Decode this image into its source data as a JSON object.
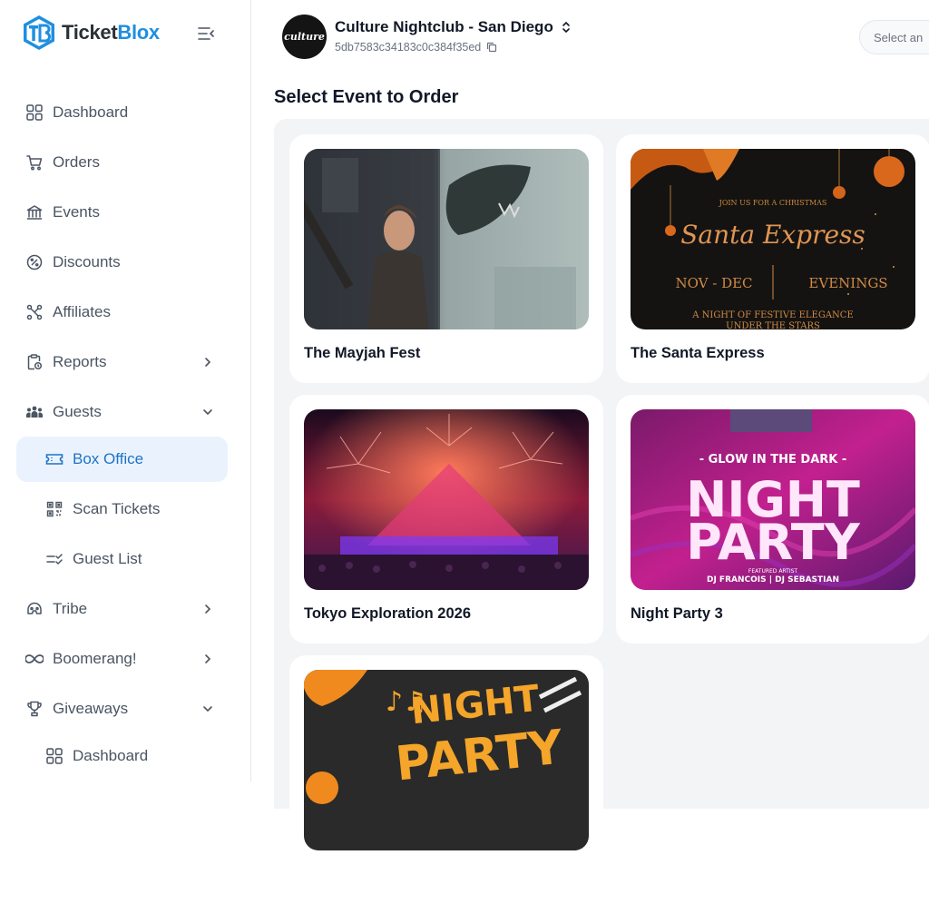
{
  "brand": {
    "part1": "Ticket",
    "part2": "Blox",
    "accent": "#1f8fe0"
  },
  "sidebar": {
    "items": [
      {
        "label": "Dashboard",
        "icon": "grid-icon"
      },
      {
        "label": "Orders",
        "icon": "cart-icon"
      },
      {
        "label": "Events",
        "icon": "building-icon"
      },
      {
        "label": "Discounts",
        "icon": "percent-icon"
      },
      {
        "label": "Affiliates",
        "icon": "network-icon"
      },
      {
        "label": "Reports",
        "icon": "report-icon"
      },
      {
        "label": "Guests",
        "icon": "people-icon"
      },
      {
        "label": "Box Office",
        "icon": "ticket-icon",
        "active": true
      },
      {
        "label": "Scan Tickets",
        "icon": "qr-icon"
      },
      {
        "label": "Guest List",
        "icon": "checklist-icon"
      },
      {
        "label": "Tribe",
        "icon": "helmet-icon"
      },
      {
        "label": "Boomerang!",
        "icon": "infinity-icon"
      },
      {
        "label": "Giveaways",
        "icon": "trophy-icon"
      },
      {
        "label": "Dashboard",
        "icon": "grid-icon"
      }
    ]
  },
  "venue": {
    "logo_text": "culture",
    "name": "Culture Nightclub - San Diego",
    "id": "5db7583c34183c0c384f35ed"
  },
  "select_placeholder": "Select an",
  "page": {
    "title": "Select Event to Order"
  },
  "events": [
    {
      "title": "The Mayjah Fest"
    },
    {
      "title": "The Santa Express",
      "poster": {
        "top": "JOIN US FOR A CHRISTMAS",
        "script": "Santa Express",
        "left": "NOV - DEC",
        "right": "EVENINGS",
        "bottom1": "A NIGHT OF FESTIVE ELEGANCE",
        "bottom2": "UNDER THE STARS"
      }
    },
    {
      "title": "Tokyo Exploration 2026"
    },
    {
      "title": "Night Party 3",
      "poster": {
        "top": "- GLOW IN THE DARK -",
        "big1": "NIGHT",
        "big2": "PARTY",
        "featured": "FEATURED ARTIST",
        "artists": "DJ FRANCOIS | DJ SEBASTIAN"
      }
    },
    {
      "title": "",
      "poster": {
        "big1": "NIGHT",
        "big2": "PARTY"
      }
    }
  ]
}
